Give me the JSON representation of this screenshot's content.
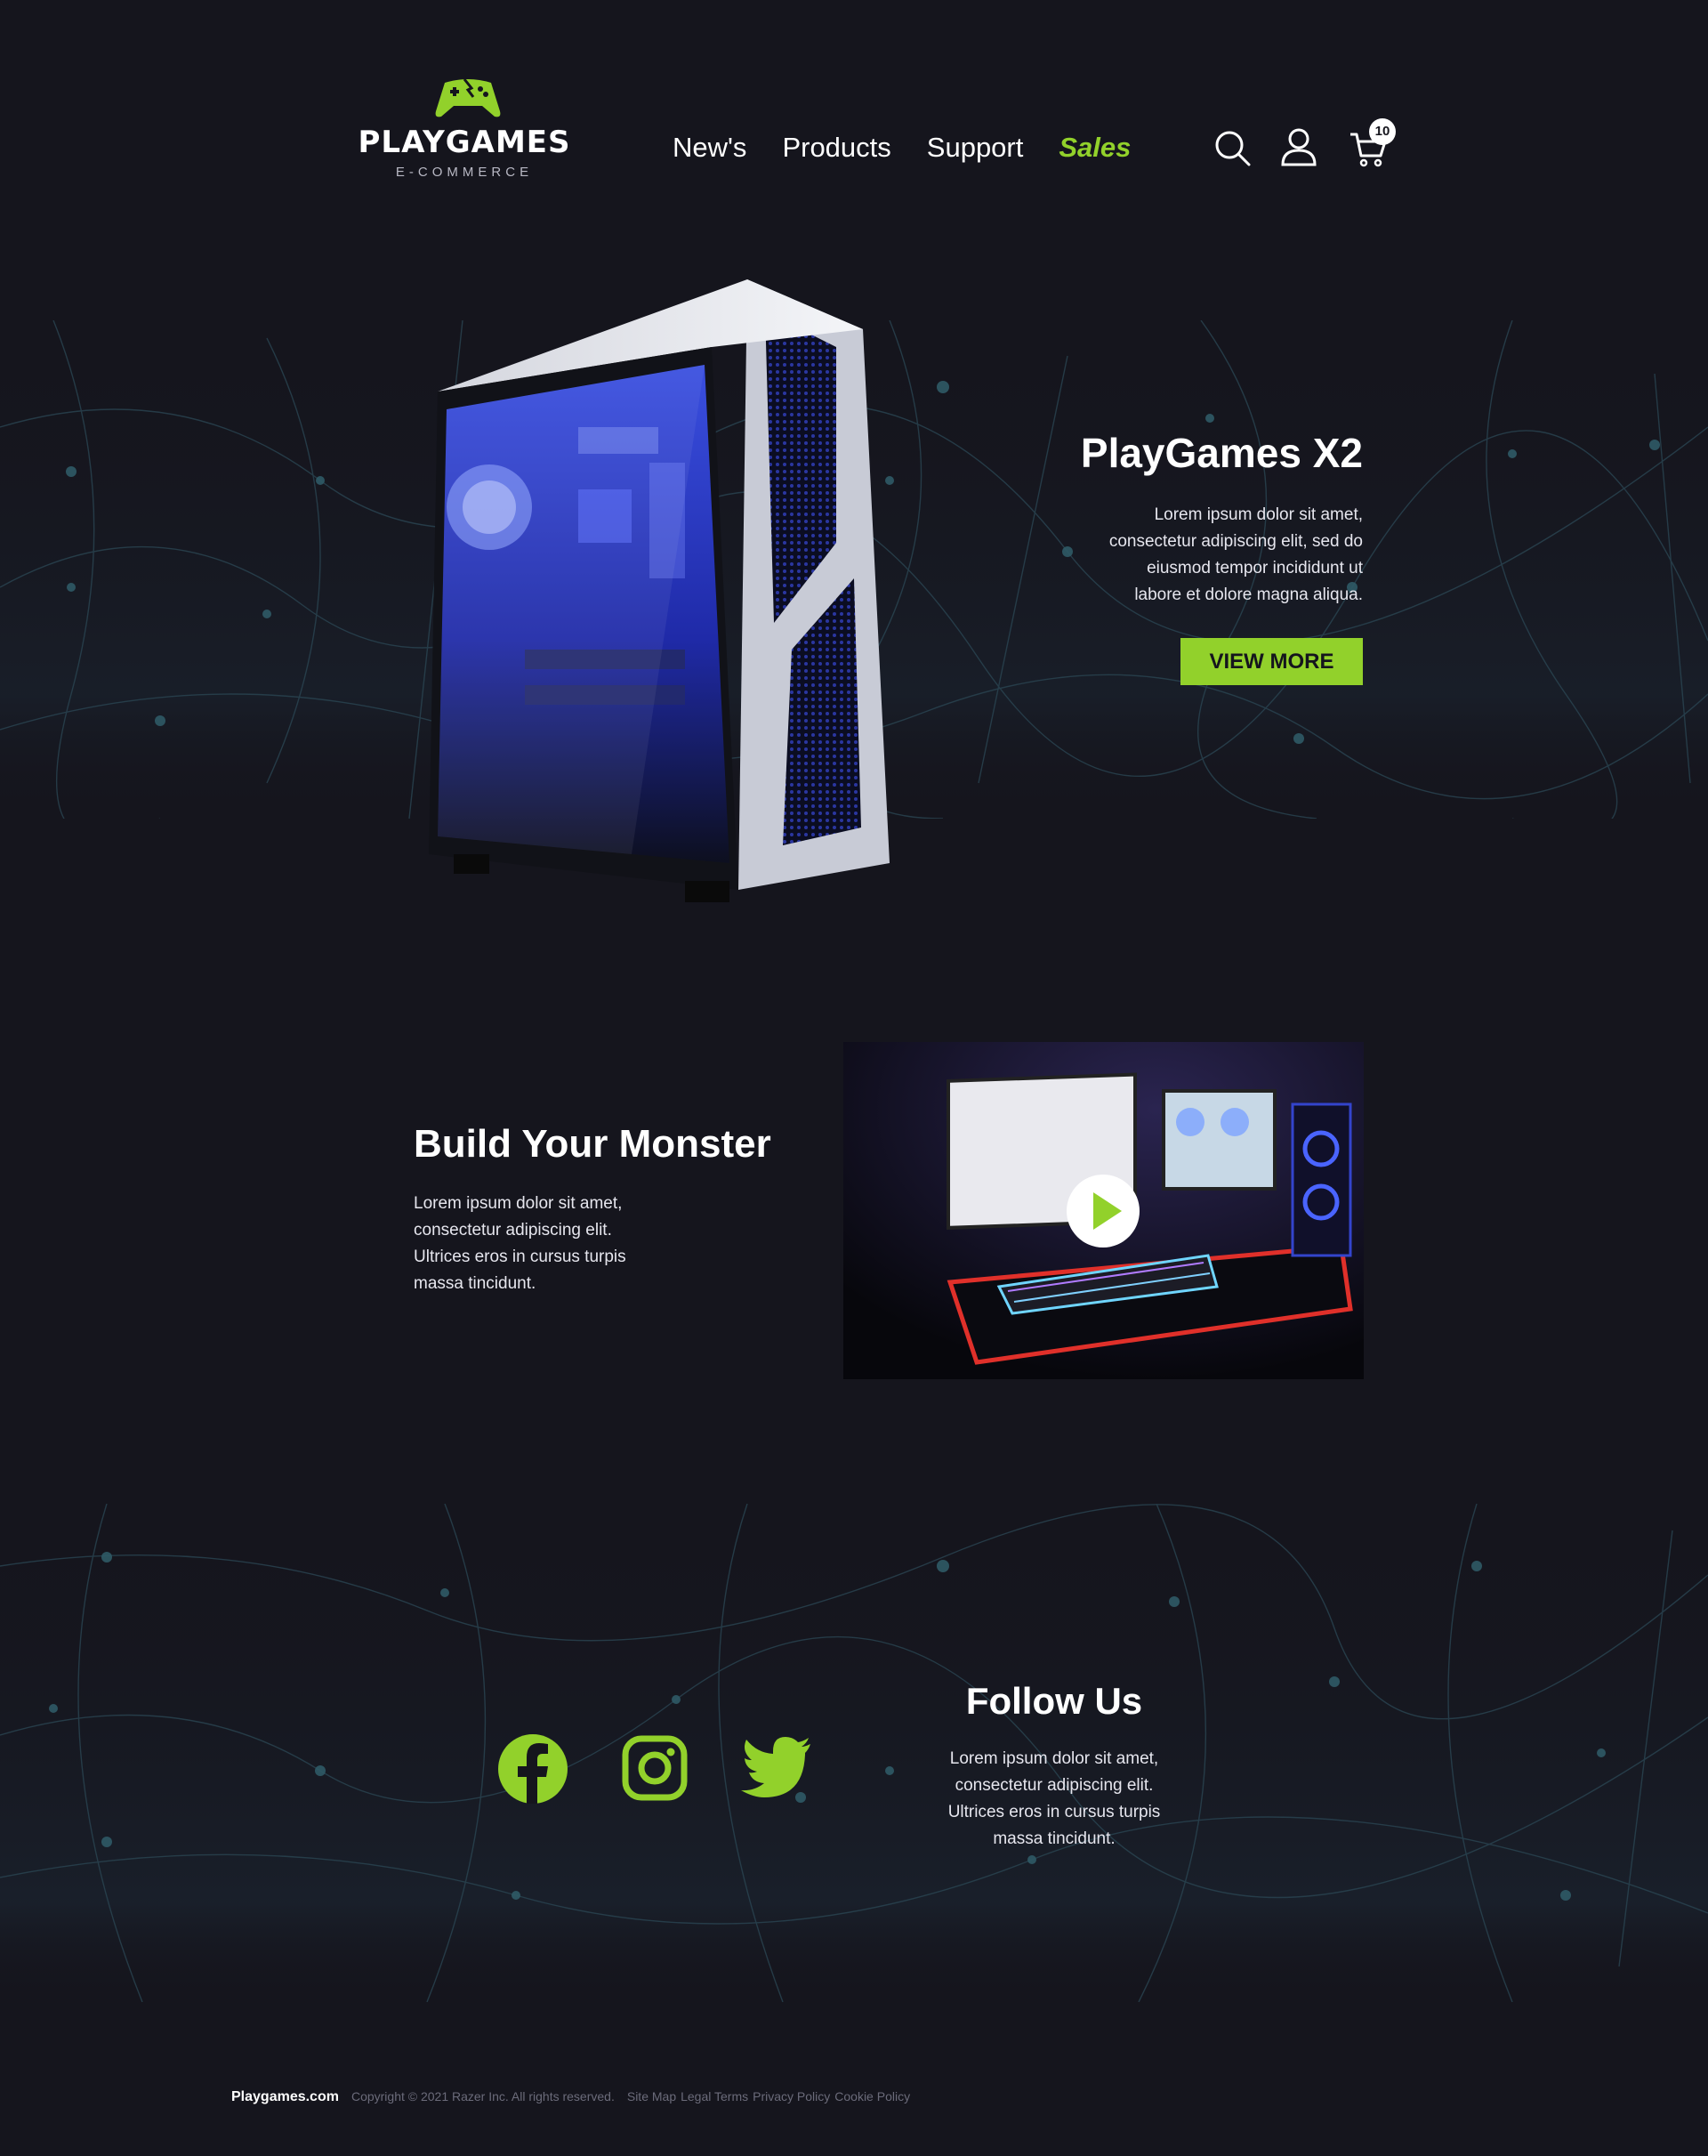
{
  "brand": {
    "name": "PLAYGAMES",
    "tagline": "E-COMMERCE",
    "accent_color": "#92d12b",
    "background_color": "#15151d"
  },
  "nav": {
    "items": [
      {
        "label": "New's"
      },
      {
        "label": "Products"
      },
      {
        "label": "Support"
      },
      {
        "label": "Sales"
      }
    ],
    "icons": [
      "search-icon",
      "user-icon",
      "cart-icon"
    ],
    "cart_count": "10"
  },
  "hero": {
    "title": "PlayGames X2",
    "description": "Lorem ipsum dolor sit amet, consectetur adipiscing elit, sed do eiusmod tempor incididunt ut labore et dolore magna aliqua.",
    "button": "VIEW MORE"
  },
  "build": {
    "title": "Build Your Monster",
    "description": "Lorem ipsum dolor sit amet, consectetur adipiscing elit. Ultrices eros in cursus turpis massa tincidunt."
  },
  "follow": {
    "title": "Follow Us",
    "description": "Lorem ipsum dolor sit amet, consectetur adipiscing elit. Ultrices eros in cursus turpis massa tincidunt.",
    "socials": [
      "facebook-icon",
      "instagram-icon",
      "twitter-icon"
    ]
  },
  "footer": {
    "brand": "Playgames.com",
    "copyright": "Copyright © 2021 Razer Inc. All rights reserved.",
    "links": [
      "Site Map",
      "Legal Terms",
      "Privacy Policy",
      "Cookie Policy"
    ]
  }
}
